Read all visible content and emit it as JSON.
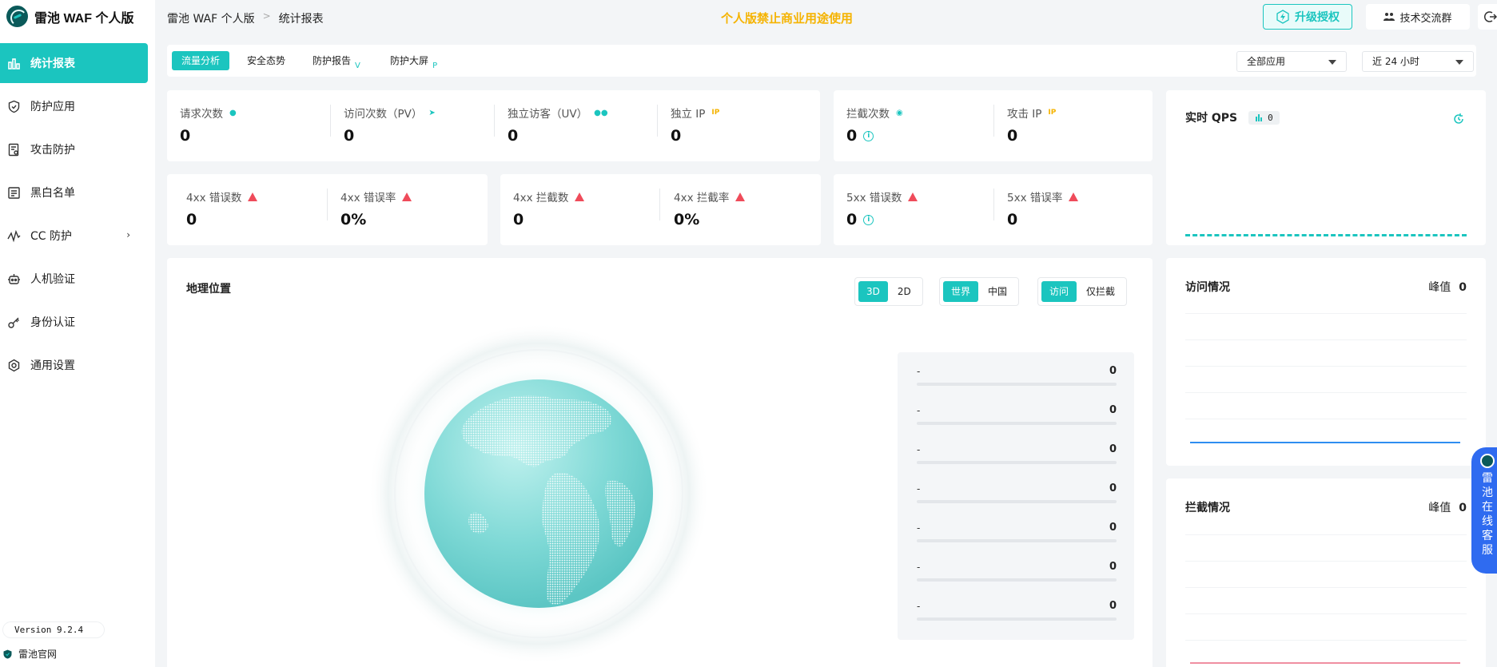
{
  "app": {
    "name": "雷池 WAF 个人版"
  },
  "sidebar": {
    "items": [
      {
        "label": "统计报表",
        "icon": "bar-chart-icon",
        "active": true
      },
      {
        "label": "防护应用",
        "icon": "shield-icon"
      },
      {
        "label": "攻击防护",
        "icon": "document-shield-icon"
      },
      {
        "label": "黑白名单",
        "icon": "list-icon"
      },
      {
        "label": "CC 防护",
        "icon": "wave-icon",
        "has_submenu": true
      },
      {
        "label": "人机验证",
        "icon": "robot-icon"
      },
      {
        "label": "身份认证",
        "icon": "key-icon"
      },
      {
        "label": "通用设置",
        "icon": "gear-icon"
      }
    ],
    "version": "Version 9.2.4",
    "official_link": "雷池官网"
  },
  "header": {
    "breadcrumb": [
      "雷池 WAF 个人版",
      "统计报表"
    ],
    "notice": "个人版禁止商业用途使用",
    "upgrade_label": "升级授权",
    "tech_group_label": "技术交流群"
  },
  "tabs": [
    {
      "label": "流量分析",
      "active": true
    },
    {
      "label": "安全态势"
    },
    {
      "label": "防护报告",
      "badge": "V"
    },
    {
      "label": "防护大屏",
      "badge": "P"
    }
  ],
  "filters": {
    "app_select": "全部应用",
    "time_select": "近 24 小时"
  },
  "stats_row1": [
    {
      "label": "请求次数",
      "value": "0",
      "icon": "user-icon"
    },
    {
      "label": "访问次数（PV）",
      "value": "0",
      "icon": "send-icon"
    },
    {
      "label": "独立访客（UV）",
      "value": "0",
      "icon": "users-icon"
    },
    {
      "label": "独立 IP",
      "value": "0",
      "icon": "ip-icon",
      "icon_text": "IP"
    }
  ],
  "stats_row1b": [
    {
      "label": "拦截次数",
      "value": "0",
      "icon": "fingerprint-icon"
    },
    {
      "label": "攻击 IP",
      "value": "0",
      "icon": "ip-icon",
      "icon_text": "IP"
    }
  ],
  "stats_row2": [
    {
      "label": "4xx 错误数",
      "value": "0"
    },
    {
      "label": "4xx 错误率",
      "value": "0%"
    },
    {
      "label": "4xx 拦截数",
      "value": "0"
    },
    {
      "label": "4xx 拦截率",
      "value": "0%"
    },
    {
      "label": "5xx 错误数",
      "value": "0"
    },
    {
      "label": "5xx 错误率",
      "value": "0"
    }
  ],
  "qps": {
    "title": "实时 QPS",
    "value": "0"
  },
  "geo": {
    "title": "地理位置",
    "view_modes": [
      "3D",
      "2D"
    ],
    "regions": [
      "世界",
      "中国"
    ],
    "types": [
      "访问",
      "仅拦截"
    ],
    "ranking": [
      {
        "name": "-",
        "value": "0"
      },
      {
        "name": "-",
        "value": "0"
      },
      {
        "name": "-",
        "value": "0"
      },
      {
        "name": "-",
        "value": "0"
      },
      {
        "name": "-",
        "value": "0"
      },
      {
        "name": "-",
        "value": "0"
      },
      {
        "name": "-",
        "value": "0"
      }
    ]
  },
  "visits": {
    "title": "访问情况",
    "peak_label": "峰值",
    "peak_value": "0"
  },
  "blocks": {
    "title": "拦截情况",
    "peak_label": "峰值",
    "peak_value": "0"
  },
  "chat": {
    "label": "雷池在线客服"
  },
  "colors": {
    "accent": "#1bc5bf",
    "warning": "#f5b300",
    "danger": "#ef4b5a",
    "chat": "#2f6bf0"
  }
}
